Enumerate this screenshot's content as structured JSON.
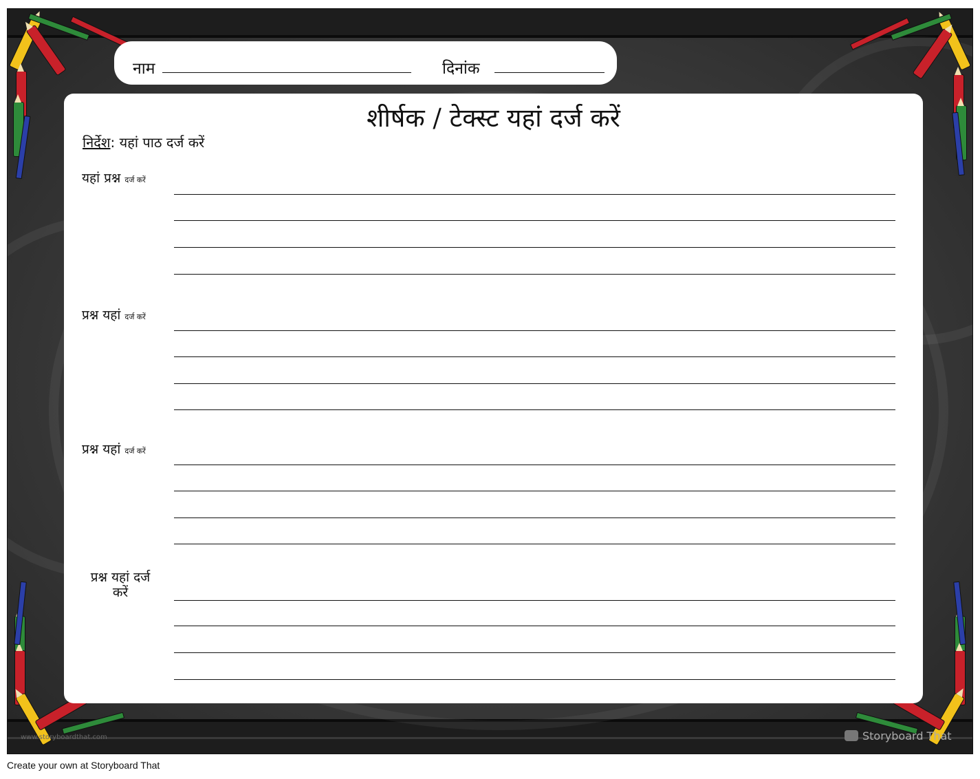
{
  "header": {
    "name_label": "नाम",
    "date_label": "दिनांक"
  },
  "worksheet": {
    "title": "शीर्षक / टेक्स्ट यहां दर्ज करें",
    "instructions_label": "निर्देश",
    "instructions_text": ": यहां पाठ दर्ज करें",
    "questions": [
      {
        "main": "यहां प्रश्न ",
        "small": "दर्ज करें"
      },
      {
        "main": "प्रश्न यहां ",
        "small": "दर्ज करें"
      },
      {
        "main": "प्रश्न यहां ",
        "small": "दर्ज करें"
      },
      {
        "main": "प्रश्न यहां दर्ज करें",
        "small": ""
      }
    ]
  },
  "watermark": {
    "left": "www.storyboardthat.com",
    "right": "Storyboard That"
  },
  "footer": {
    "text": "Create your own at Storyboard That"
  },
  "colors": {
    "board": "#3e3e3e",
    "paper": "#ffffff",
    "crayon_red": "#c8212a",
    "crayon_yellow": "#f2c21b",
    "crayon_green": "#2e8b3a",
    "crayon_blue": "#2b3fa8"
  }
}
